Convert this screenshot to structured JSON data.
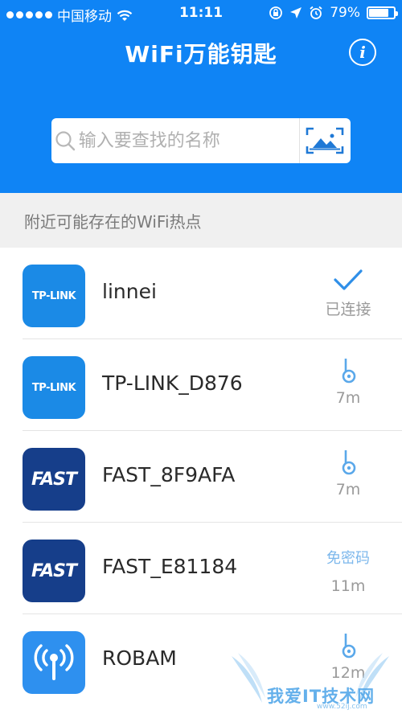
{
  "status_bar": {
    "carrier": "中国移动",
    "time": "11:11",
    "battery": "79%",
    "battery_level": 0.79
  },
  "header": {
    "title": "WiFi万能钥匙",
    "info_icon": "info-icon"
  },
  "search": {
    "placeholder": "输入要查找的名称",
    "search_icon": "search-icon",
    "scan_icon": "scan-icon"
  },
  "section": {
    "title": "附近可能存在的WiFi热点"
  },
  "networks": [
    {
      "name": "linnei",
      "logo": "TP-LINK",
      "status_icon": "checkmark-icon",
      "status": "已连接"
    },
    {
      "name": "TP-LINK_D876",
      "logo": "TP-LINK",
      "status_icon": "key-icon",
      "status": "7m"
    },
    {
      "name": "FAST_8F9AFA",
      "logo": "FAST",
      "status_icon": "key-icon",
      "status": "7m"
    },
    {
      "name": "FAST_E81184",
      "logo": "FAST",
      "status_label": "免密码",
      "status": "11m"
    },
    {
      "name": "ROBAM",
      "logo": "",
      "status_icon": "key-icon",
      "status": "12m"
    }
  ],
  "watermark": {
    "text": "我爱IT技术网",
    "sub": "www.52ij.com"
  },
  "colors": {
    "brand_blue": "#0f84f5",
    "tplink_blue": "#1b8ae6",
    "fast_navy": "#163e8a",
    "key_blue": "#5aa8ea",
    "free_text": "#7db8ec"
  }
}
